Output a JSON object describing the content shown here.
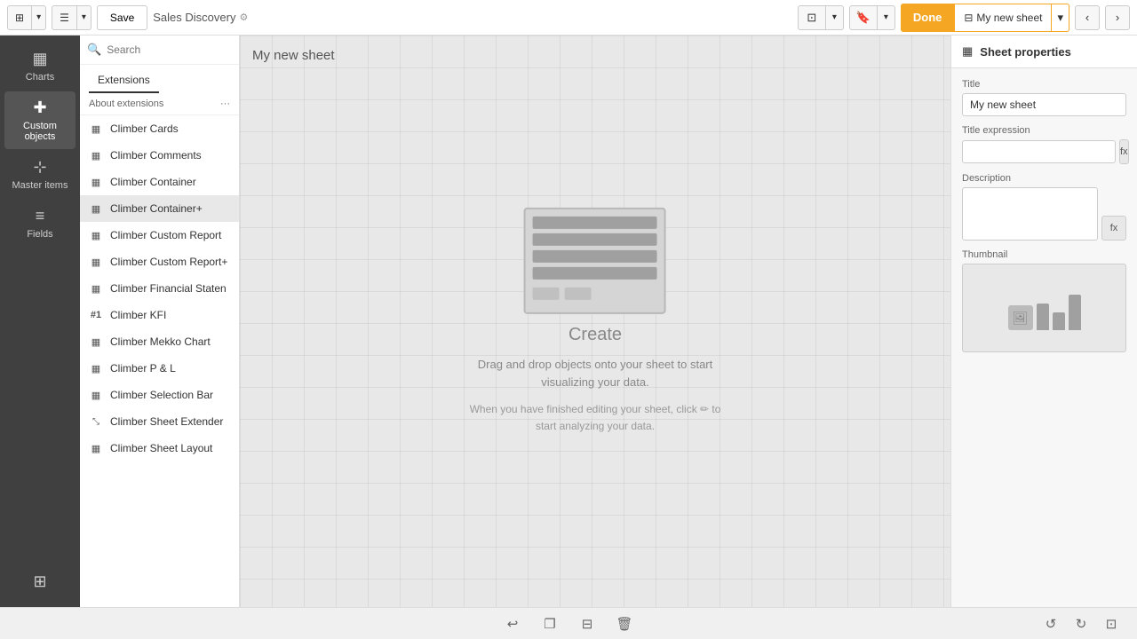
{
  "topbar": {
    "view_icon": "⊞",
    "list_icon": "☰",
    "save_label": "Save",
    "app_name": "Sales Discovery",
    "app_icon": "⚙",
    "edit_icon": "✏",
    "done_label": "Done",
    "sheet_name": "My new sheet",
    "sheet_name_icon": "⊟",
    "nav_prev": "‹",
    "nav_next": "›",
    "monitor_icon": "⊡",
    "bookmark_icon": "🔖"
  },
  "sidebar": {
    "items": [
      {
        "id": "charts",
        "icon": "▦",
        "label": "Charts"
      },
      {
        "id": "custom-objects",
        "icon": "✚",
        "label": "Custom objects"
      },
      {
        "id": "master-items",
        "icon": "⊹",
        "label": "Master items"
      },
      {
        "id": "fields",
        "icon": "≡",
        "label": "Fields"
      }
    ],
    "bottom_icon": "⊞"
  },
  "extensions_panel": {
    "search_placeholder": "Search",
    "tab_label": "Extensions",
    "section_header": "About extensions",
    "section_more": "···",
    "items": [
      {
        "id": "climber-cards",
        "icon": "▦",
        "label": "Climber Cards"
      },
      {
        "id": "climber-comments",
        "icon": "▦",
        "label": "Climber Comments"
      },
      {
        "id": "climber-container",
        "icon": "▦",
        "label": "Climber Container"
      },
      {
        "id": "climber-container2",
        "icon": "▦",
        "label": "Climber Container+"
      },
      {
        "id": "climber-custom-report",
        "icon": "▦",
        "label": "Climber Custom Report"
      },
      {
        "id": "climber-custom-report2",
        "icon": "▦",
        "label": "Climber Custom Report+"
      },
      {
        "id": "climber-financial",
        "icon": "▦",
        "label": "Climber Financial Staten"
      },
      {
        "id": "climber-kfi",
        "icon": "#1",
        "label": "Climber KFI"
      },
      {
        "id": "climber-mekko",
        "icon": "▦",
        "label": "Climber Mekko Chart"
      },
      {
        "id": "climber-pl",
        "icon": "▦",
        "label": "Climber P & L"
      },
      {
        "id": "climber-selection",
        "icon": "▦",
        "label": "Climber Selection Bar"
      },
      {
        "id": "climber-sheet-ext",
        "icon": "⤡",
        "label": "Climber Sheet Extender"
      },
      {
        "id": "climber-sheet-layout",
        "icon": "▦",
        "label": "Climber Sheet Layout"
      }
    ]
  },
  "canvas": {
    "title": "My new sheet",
    "create_label": "Create",
    "create_sub": "Drag and drop objects onto your sheet to start\nvisualizing your data.",
    "create_hint": "When you have finished editing your sheet, click\n to start analyzing your data."
  },
  "sheet_properties": {
    "panel_icon": "▦",
    "panel_title": "Sheet properties",
    "title_label": "Title",
    "title_value": "My new sheet",
    "title_expr_label": "Title expression",
    "title_expr_placeholder": "",
    "description_label": "Description",
    "description_value": "",
    "thumbnail_label": "Thumbnail",
    "fx_symbol": "fx"
  },
  "bottom_bar": {
    "icons": [
      "↩",
      "❐",
      "⊟",
      "🗑",
      "↺",
      "↻",
      "⊡"
    ]
  }
}
